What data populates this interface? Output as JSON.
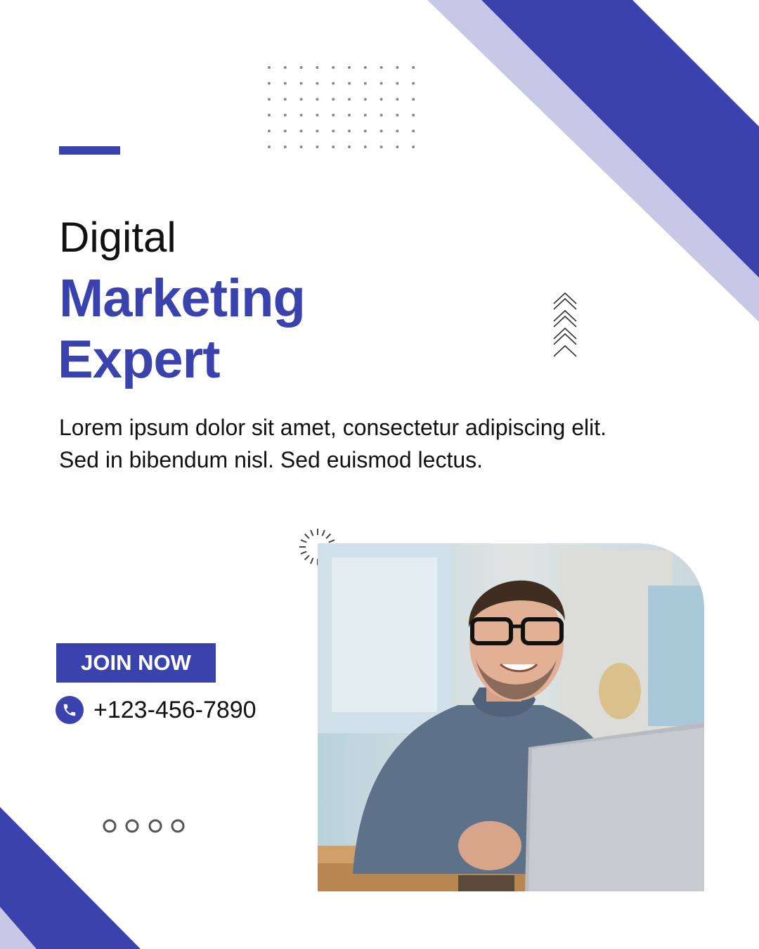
{
  "colors": {
    "accent": "#3a42ad",
    "light_accent": "#c6c8e6",
    "text": "#111111",
    "background": "#ffffff"
  },
  "headline": {
    "line1": "Digital",
    "line2": "Marketing",
    "line3": "Expert"
  },
  "description": {
    "line1": "Lorem ipsum dolor sit amet, consectetur adipiscing elit.",
    "line2": "Sed in bibendum nisl. Sed euismod lectus."
  },
  "cta": {
    "label": "JOIN NOW"
  },
  "contact": {
    "icon": "phone-icon",
    "phone": "+123-456-7890"
  },
  "photo": {
    "subject": "smiling man with glasses at a laptop"
  },
  "decor": {
    "dot_grid": "dot-grid-icon",
    "chevrons": "chevron-up-icon",
    "sunburst": "sunburst-icon",
    "circles": "circle-outline-icon"
  }
}
